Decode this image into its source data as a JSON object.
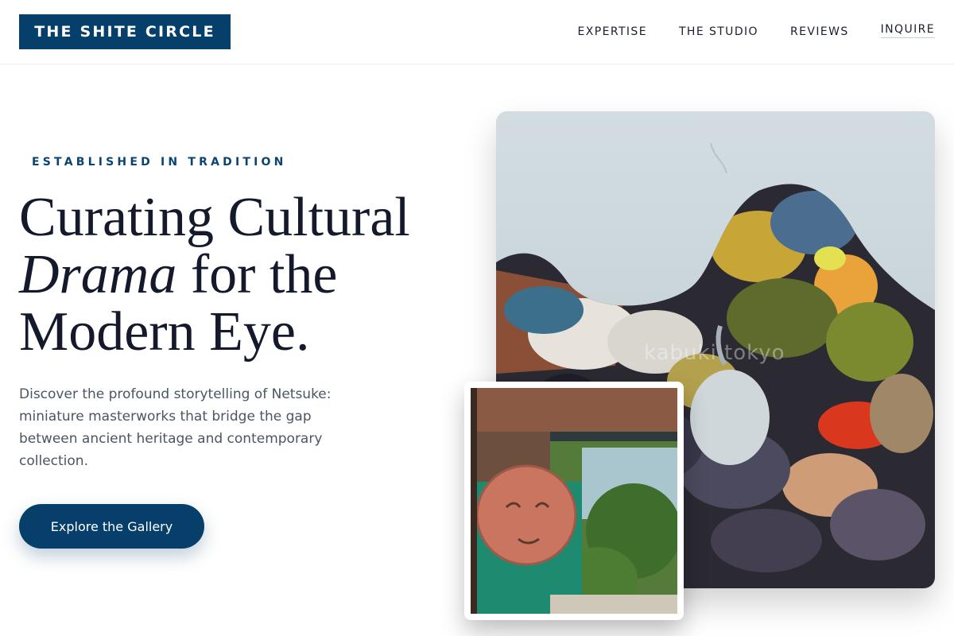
{
  "header": {
    "logo": "THE SHITE CIRCLE",
    "nav": [
      "EXPERTISE",
      "THE STUDIO",
      "REVIEWS",
      "INQUIRE"
    ]
  },
  "hero": {
    "eyebrow": "ESTABLISHED IN TRADITION",
    "headline_line1": "Curating Cultural",
    "headline_italic": "Drama",
    "headline_line2_rest": " for the",
    "headline_line3": "Modern Eye.",
    "lede": "Discover the profound storytelling of Netsuke: miniature masterworks that bridge the gap between ancient heritage and contemporary collection.",
    "cta": "Explore the Gallery"
  },
  "images": {
    "main_watermark": "kabuki tokyo"
  },
  "colors": {
    "brand": "#073f6b",
    "text": "#141a2b",
    "muted": "#4b5563"
  }
}
